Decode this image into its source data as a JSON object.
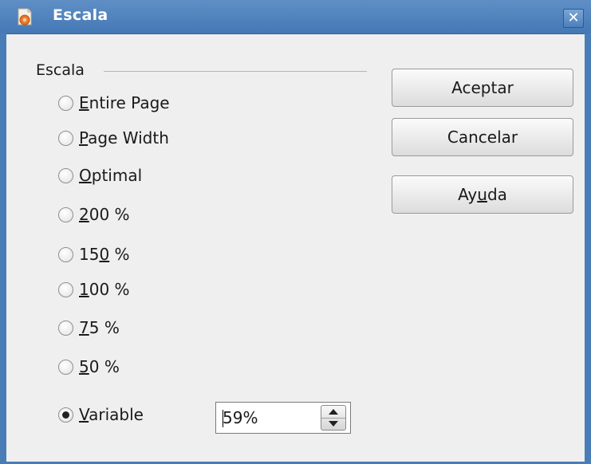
{
  "window": {
    "title": "Escala",
    "close_glyph": "✕",
    "app_icon": "impress-app-icon"
  },
  "group": {
    "label": "Escala"
  },
  "options": [
    {
      "pre": "",
      "key": "E",
      "post": "ntire Page",
      "checked": false
    },
    {
      "pre": "",
      "key": "P",
      "post": "age Width",
      "checked": false
    },
    {
      "pre": "",
      "key": "O",
      "post": "ptimal",
      "checked": false
    },
    {
      "pre": "",
      "key": "2",
      "post": "00 %",
      "checked": false
    },
    {
      "pre": "15",
      "key": "0",
      "post": " %",
      "checked": false
    },
    {
      "pre": "",
      "key": "1",
      "post": "00 %",
      "checked": false
    },
    {
      "pre": "",
      "key": "7",
      "post": "5 %",
      "checked": false
    },
    {
      "pre": "",
      "key": "5",
      "post": "0 %",
      "checked": false
    }
  ],
  "variable": {
    "pre": "",
    "key": "V",
    "post": "ariable",
    "checked": true,
    "value": "59%"
  },
  "buttons": {
    "ok": {
      "pre": "Aceptar",
      "key": "",
      "post": ""
    },
    "cancel": {
      "pre": "Cancelar",
      "key": "",
      "post": ""
    },
    "help": {
      "pre": "Ay",
      "key": "u",
      "post": "da"
    }
  },
  "colors": {
    "titlebar": "#4a7db8",
    "window_bg": "#efefef"
  }
}
